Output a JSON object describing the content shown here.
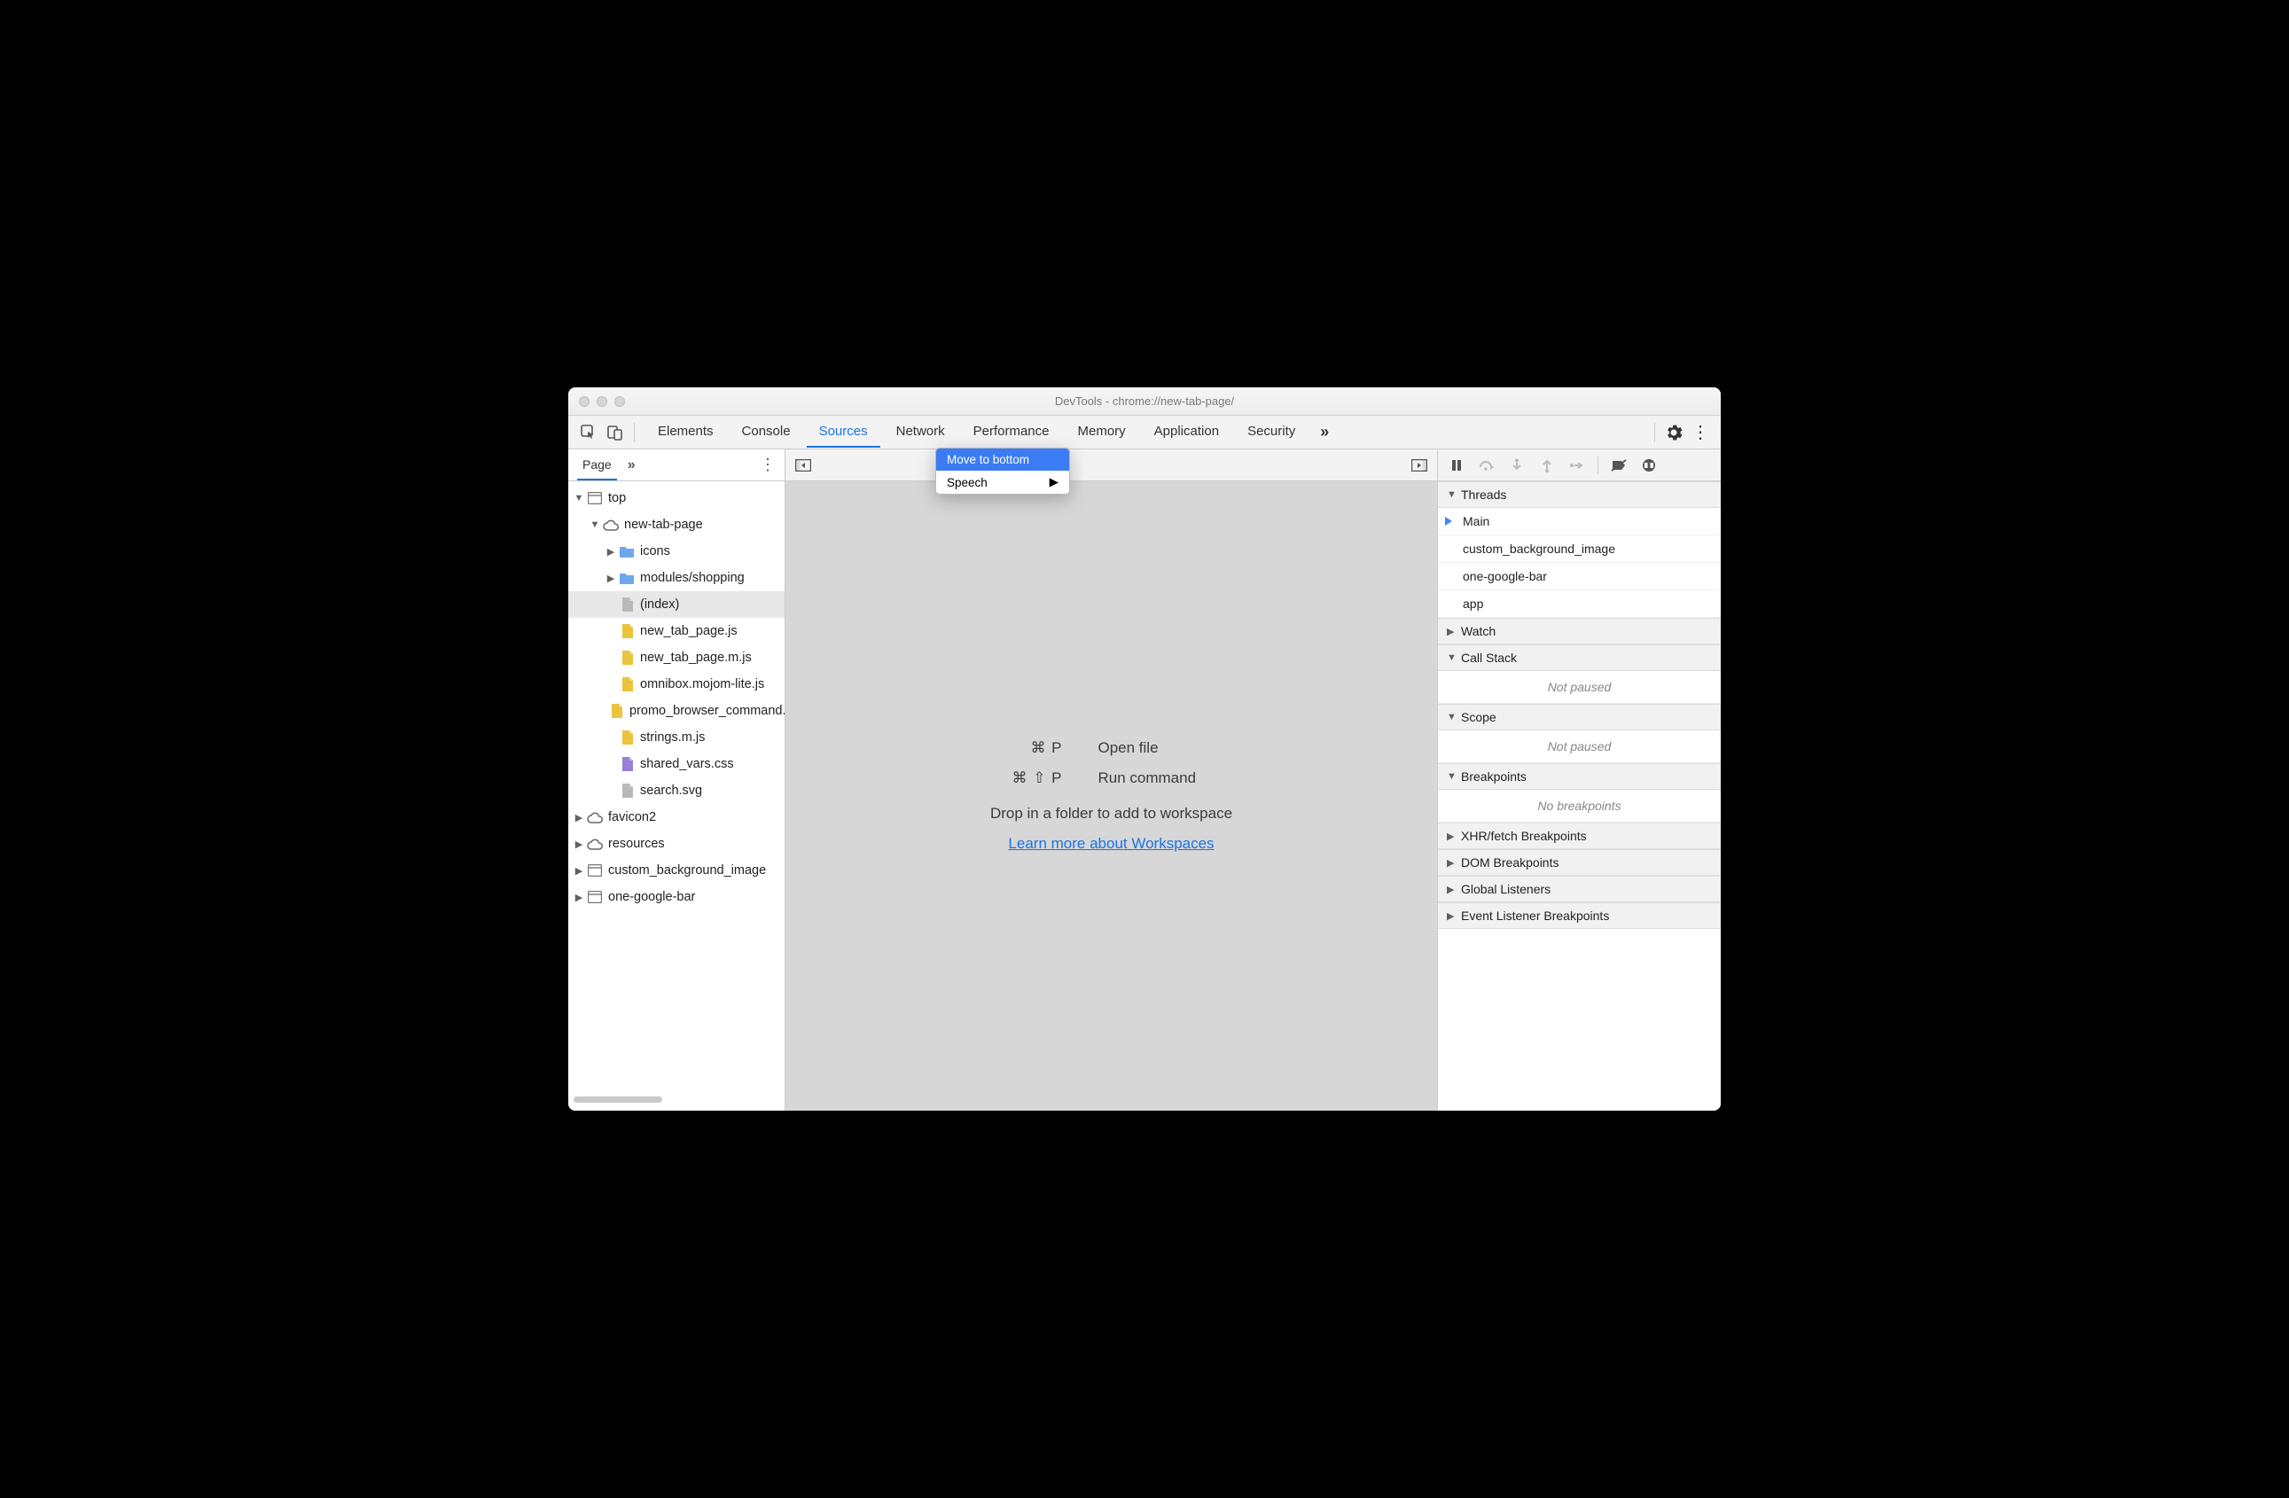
{
  "window_title": "DevTools - chrome://new-tab-page/",
  "tabs": [
    "Elements",
    "Console",
    "Sources",
    "Network",
    "Performance",
    "Memory",
    "Application",
    "Security"
  ],
  "active_tab": "Sources",
  "left": {
    "tab": "Page",
    "tree": [
      {
        "depth": 0,
        "arrow": "down",
        "icon": "frame",
        "label": "top"
      },
      {
        "depth": 1,
        "arrow": "down",
        "icon": "cloud",
        "label": "new-tab-page"
      },
      {
        "depth": 2,
        "arrow": "right",
        "icon": "folder",
        "label": "icons"
      },
      {
        "depth": 2,
        "arrow": "right",
        "icon": "folder",
        "label": "modules/shopping"
      },
      {
        "depth": 2,
        "arrow": "",
        "icon": "doc",
        "label": "(index)",
        "selected": true
      },
      {
        "depth": 2,
        "arrow": "",
        "icon": "js",
        "label": "new_tab_page.js"
      },
      {
        "depth": 2,
        "arrow": "",
        "icon": "js",
        "label": "new_tab_page.m.js"
      },
      {
        "depth": 2,
        "arrow": "",
        "icon": "js",
        "label": "omnibox.mojom-lite.js"
      },
      {
        "depth": 2,
        "arrow": "",
        "icon": "js",
        "label": "promo_browser_command.mojom"
      },
      {
        "depth": 2,
        "arrow": "",
        "icon": "js",
        "label": "strings.m.js"
      },
      {
        "depth": 2,
        "arrow": "",
        "icon": "css",
        "label": "shared_vars.css"
      },
      {
        "depth": 2,
        "arrow": "",
        "icon": "doc",
        "label": "search.svg"
      },
      {
        "depth": 0,
        "arrow": "right",
        "icon": "cloud",
        "label": "favicon2"
      },
      {
        "depth": 0,
        "arrow": "right",
        "icon": "cloud",
        "label": "resources"
      },
      {
        "depth": 0,
        "arrow": "right",
        "icon": "frame",
        "label": "custom_background_image"
      },
      {
        "depth": 0,
        "arrow": "right",
        "icon": "frame",
        "label": "one-google-bar"
      }
    ]
  },
  "center": {
    "open_key": "⌘ P",
    "open_label": "Open file",
    "run_key": "⌘ ⇧ P",
    "run_label": "Run command",
    "drop_text": "Drop in a folder to add to workspace",
    "link_text": "Learn more about Workspaces"
  },
  "right": {
    "threads_header": "Threads",
    "threads": [
      "Main",
      "custom_background_image",
      "one-google-bar",
      "app"
    ],
    "watch_header": "Watch",
    "callstack_header": "Call Stack",
    "not_paused": "Not paused",
    "scope_header": "Scope",
    "breakpoints_header": "Breakpoints",
    "no_breakpoints": "No breakpoints",
    "xhr_header": "XHR/fetch Breakpoints",
    "dom_header": "DOM Breakpoints",
    "global_header": "Global Listeners",
    "event_header": "Event Listener Breakpoints"
  },
  "context_menu": {
    "item1": "Move to bottom",
    "item2": "Speech"
  }
}
